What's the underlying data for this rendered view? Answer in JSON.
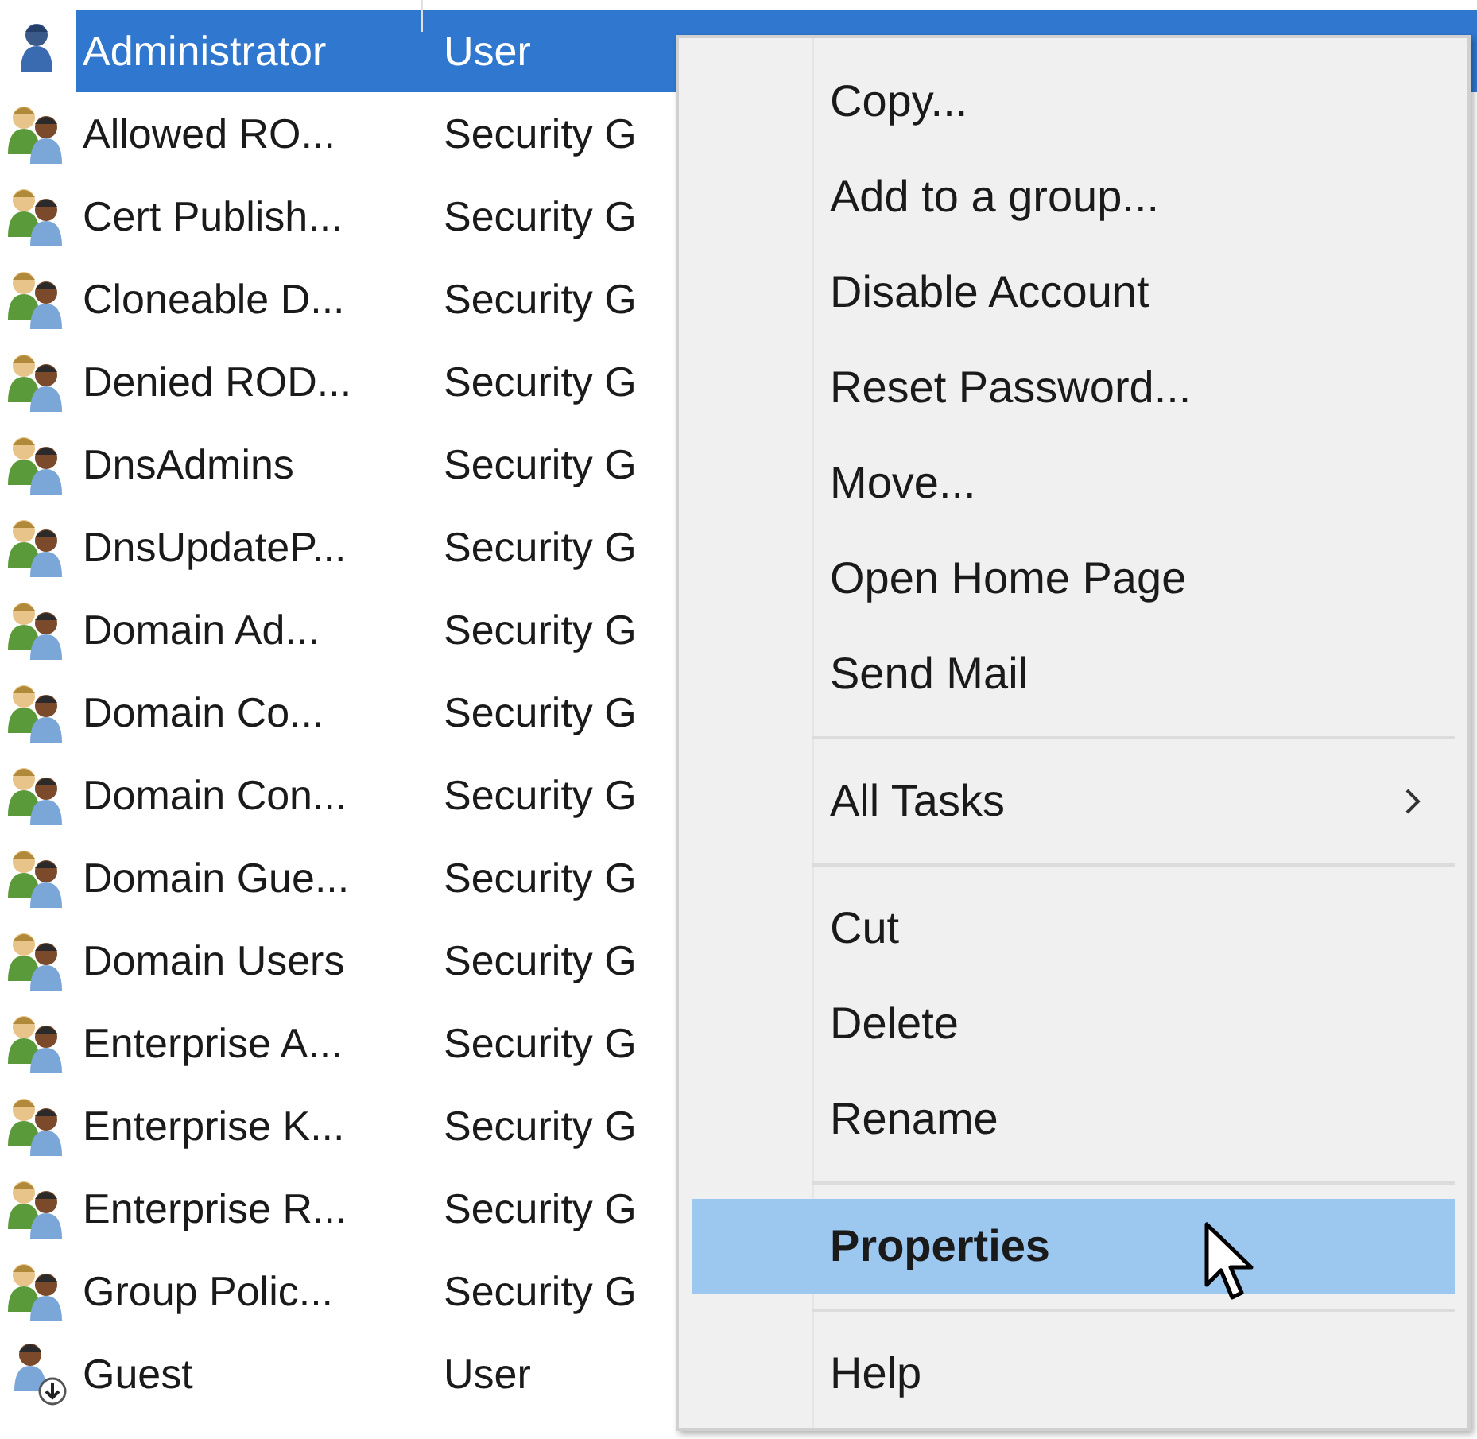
{
  "list": {
    "rows": [
      {
        "kind": "user",
        "name": "Administrator",
        "type": "User",
        "selected": true
      },
      {
        "kind": "group",
        "name": "Allowed RO...",
        "type": "Security G",
        "selected": false
      },
      {
        "kind": "group",
        "name": "Cert Publish...",
        "type": "Security G",
        "selected": false
      },
      {
        "kind": "group",
        "name": "Cloneable D...",
        "type": "Security G",
        "selected": false
      },
      {
        "kind": "group",
        "name": "Denied ROD...",
        "type": "Security G",
        "selected": false
      },
      {
        "kind": "group",
        "name": "DnsAdmins",
        "type": "Security G",
        "selected": false
      },
      {
        "kind": "group",
        "name": "DnsUpdateP...",
        "type": "Security G",
        "selected": false
      },
      {
        "kind": "group",
        "name": "Domain Ad...",
        "type": "Security G",
        "selected": false
      },
      {
        "kind": "group",
        "name": "Domain Co...",
        "type": "Security G",
        "selected": false
      },
      {
        "kind": "group",
        "name": "Domain Con...",
        "type": "Security G",
        "selected": false
      },
      {
        "kind": "group",
        "name": "Domain Gue...",
        "type": "Security G",
        "selected": false
      },
      {
        "kind": "group",
        "name": "Domain Users",
        "type": "Security G",
        "selected": false
      },
      {
        "kind": "group",
        "name": "Enterprise A...",
        "type": "Security G",
        "selected": false
      },
      {
        "kind": "group",
        "name": "Enterprise K...",
        "type": "Security G",
        "selected": false
      },
      {
        "kind": "group",
        "name": "Enterprise R...",
        "type": "Security G",
        "selected": false
      },
      {
        "kind": "group",
        "name": "Group Polic...",
        "type": "Security G",
        "selected": false
      },
      {
        "kind": "disabled-user",
        "name": "Guest",
        "type": "User",
        "selected": false
      }
    ]
  },
  "context_menu": {
    "items": [
      {
        "kind": "item",
        "label": "Copy...",
        "selected": false
      },
      {
        "kind": "item",
        "label": "Add to a group...",
        "selected": false
      },
      {
        "kind": "item",
        "label": "Disable Account",
        "selected": false
      },
      {
        "kind": "item",
        "label": "Reset Password...",
        "selected": false
      },
      {
        "kind": "item",
        "label": "Move...",
        "selected": false
      },
      {
        "kind": "item",
        "label": "Open Home Page",
        "selected": false
      },
      {
        "kind": "item",
        "label": "Send Mail",
        "selected": false
      },
      {
        "kind": "separator"
      },
      {
        "kind": "submenu",
        "label": "All Tasks",
        "selected": false
      },
      {
        "kind": "separator"
      },
      {
        "kind": "item",
        "label": "Cut",
        "selected": false
      },
      {
        "kind": "item",
        "label": "Delete",
        "selected": false
      },
      {
        "kind": "item",
        "label": "Rename",
        "selected": false
      },
      {
        "kind": "separator"
      },
      {
        "kind": "default",
        "label": "Properties",
        "selected": true
      },
      {
        "kind": "separator"
      },
      {
        "kind": "item",
        "label": "Help",
        "selected": false
      }
    ]
  }
}
